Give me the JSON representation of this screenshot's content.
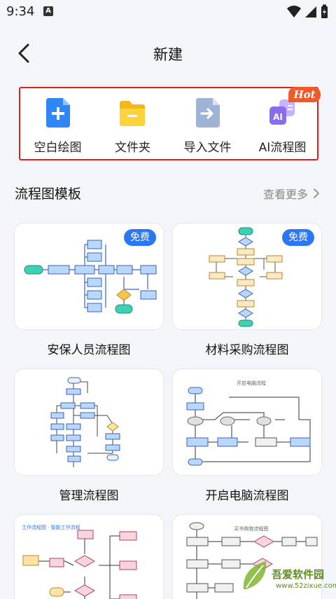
{
  "status_bar": {
    "time": "9:34",
    "notification_letter": "A"
  },
  "header": {
    "title": "新建"
  },
  "quick_actions": {
    "items": [
      {
        "label": "空白绘图",
        "icon": "blank-doc-plus-icon"
      },
      {
        "label": "文件夹",
        "icon": "folder-icon"
      },
      {
        "label": "导入文件",
        "icon": "import-file-icon"
      },
      {
        "label": "AI流程图",
        "icon": "ai-flowchart-icon"
      }
    ],
    "hot_badge": "Hot"
  },
  "templates": {
    "section_title": "流程图模板",
    "see_more": "查看更多",
    "free_badge": "免费",
    "cards": [
      {
        "label": "安保人员流程图",
        "free": true
      },
      {
        "label": "材料采购流程图",
        "free": true
      },
      {
        "label": "管理流程图",
        "free": false,
        "heading": ""
      },
      {
        "label": "开启电脑流程图",
        "free": false,
        "heading": "开启电脑流程"
      },
      {
        "label": "",
        "free": false,
        "heading": "工作流程图 · 智能工作流程"
      },
      {
        "label": "",
        "free": false,
        "heading": "买书购物流程图"
      }
    ]
  },
  "watermark": {
    "line1": "吾爱软件园",
    "line2": "www.52zixue.com"
  },
  "colors": {
    "accent_blue": "#2b78f6",
    "hot_orange": "#f05a2a",
    "highlight_red": "#e02020",
    "folder_yellow": "#f7c51e"
  }
}
